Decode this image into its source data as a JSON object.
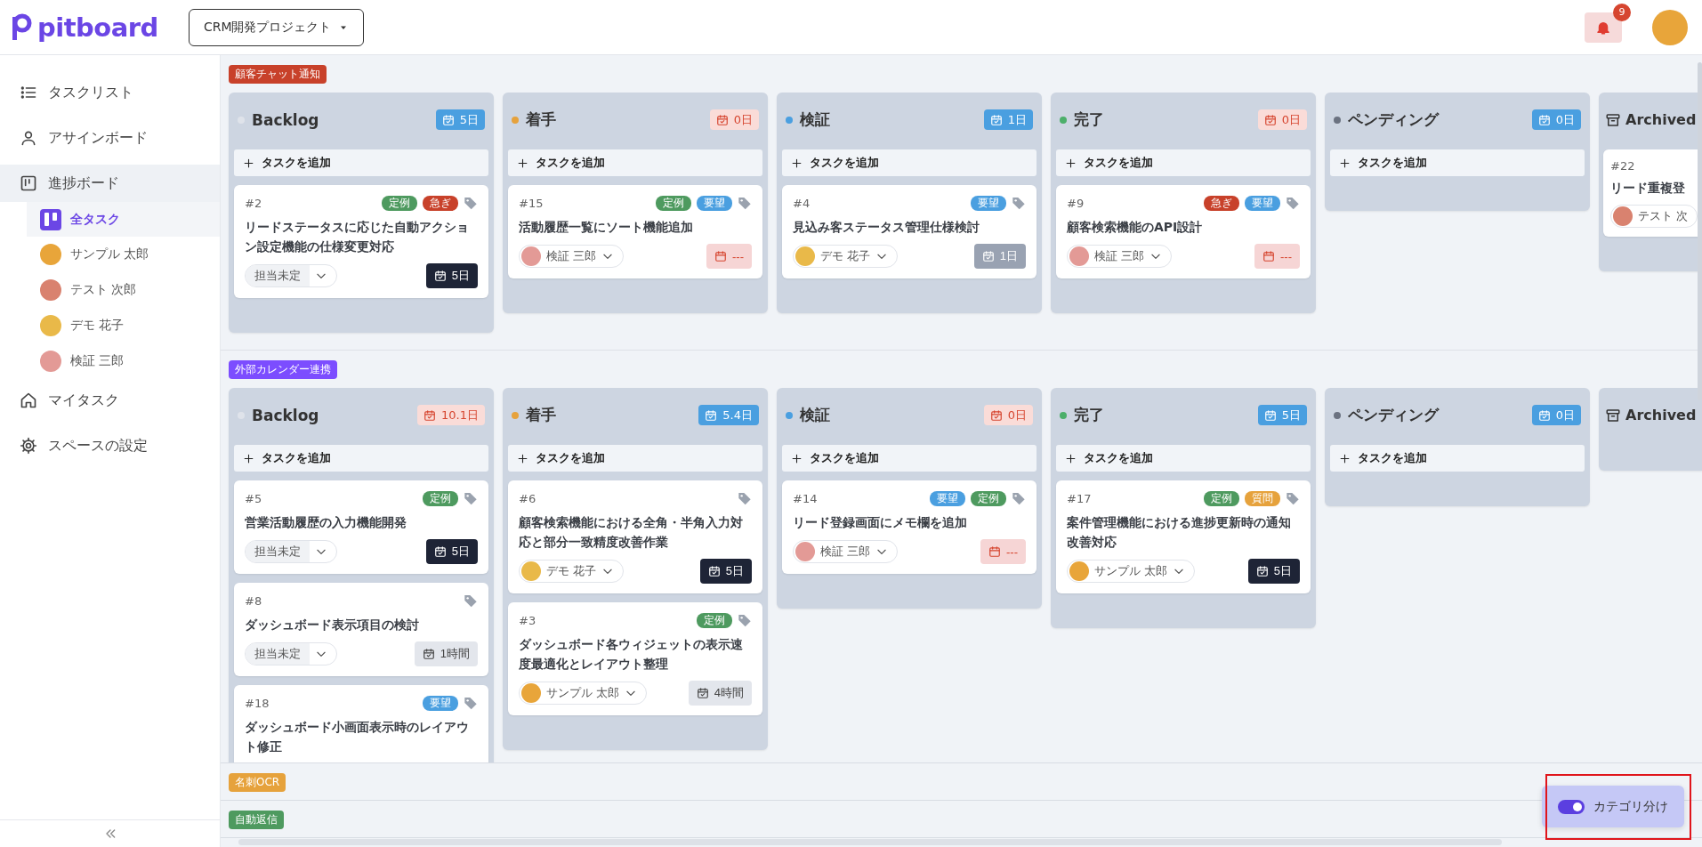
{
  "header": {
    "logo": "pitboard",
    "project": "CRM開発プロジェクト",
    "notification_count": "9"
  },
  "sidebar": {
    "items": [
      {
        "label": "タスクリスト",
        "kind": "list",
        "selected": false
      },
      {
        "label": "アサインボード",
        "kind": "person",
        "selected": false
      },
      {
        "label": "進捗ボード",
        "kind": "board",
        "selected": true,
        "children": [
          {
            "label": "全タスク",
            "kind": "all",
            "selected": true
          },
          {
            "label": "サンプル 太郎",
            "kind": "member",
            "color": "#e8a53a",
            "selected": false
          },
          {
            "label": "テスト 次郎",
            "kind": "member",
            "color": "#d9826f",
            "selected": false
          },
          {
            "label": "デモ 花子",
            "kind": "member",
            "color": "#e9b949",
            "selected": false
          },
          {
            "label": "検証 三郎",
            "kind": "member",
            "color": "#e39a96",
            "selected": false
          }
        ]
      },
      {
        "label": "マイタスク",
        "kind": "home",
        "selected": false
      },
      {
        "label": "スペースの設定",
        "kind": "gear",
        "selected": false
      }
    ]
  },
  "sections": [
    {
      "category": "顧客チャット通知",
      "color": "#c8412a",
      "columns": [
        {
          "title": "Backlog",
          "kind": "status",
          "color": "#dfe3ea",
          "badge": {
            "text": "5日",
            "alert": false
          },
          "add_label": "タスクを追加",
          "cards": [
            {
              "number": "#2",
              "tags": [
                {
                  "label": "定例",
                  "color": "#4e9a5f"
                },
                {
                  "label": "急ぎ",
                  "color": "#c8412a"
                }
              ],
              "title": "リードステータスに応じた自動アクション設定機能の仕様変更対応",
              "assignee": {
                "name": "担当未定",
                "kind": "none"
              },
              "due": {
                "text": "5日",
                "kind": "dark"
              }
            }
          ]
        },
        {
          "title": "着手",
          "kind": "status",
          "color": "#e6a23c",
          "badge": {
            "text": "0日",
            "alert": true
          },
          "add_label": "タスクを追加",
          "cards": [
            {
              "number": "#15",
              "tags": [
                {
                  "label": "定例",
                  "color": "#4e9a5f"
                },
                {
                  "label": "要望",
                  "color": "#4a9fe0"
                }
              ],
              "title": "活動履歴一覧にソート機能追加",
              "assignee": {
                "name": "検証 三郎",
                "kind": "member",
                "color": "#e39a96"
              },
              "due": {
                "text": "---",
                "kind": "overdue"
              }
            }
          ]
        },
        {
          "title": "検証",
          "kind": "status",
          "color": "#4a9fe0",
          "badge": {
            "text": "1日",
            "alert": false
          },
          "add_label": "タスクを追加",
          "cards": [
            {
              "number": "#4",
              "tags": [
                {
                  "label": "要望",
                  "color": "#4a9fe0"
                }
              ],
              "title": "見込み客ステータス管理仕様検討",
              "assignee": {
                "name": "デモ 花子",
                "kind": "member",
                "color": "#e9b949"
              },
              "due": {
                "text": "1日",
                "kind": "grey"
              }
            }
          ]
        },
        {
          "title": "完了",
          "kind": "status",
          "color": "#4caf6a",
          "badge": {
            "text": "0日",
            "alert": true
          },
          "add_label": "タスクを追加",
          "cards": [
            {
              "number": "#9",
              "tags": [
                {
                  "label": "急ぎ",
                  "color": "#c8412a"
                },
                {
                  "label": "要望",
                  "color": "#4a9fe0"
                }
              ],
              "title": "顧客検索機能のAPI設計",
              "assignee": {
                "name": "検証 三郎",
                "kind": "member",
                "color": "#e39a96"
              },
              "due": {
                "text": "---",
                "kind": "overdue"
              }
            }
          ]
        },
        {
          "title": "ペンディング",
          "kind": "status",
          "color": "#6b7280",
          "badge": {
            "text": "0日",
            "alert": false
          },
          "add_label": "タスクを追加"
        },
        {
          "title": "Archived",
          "kind": "archive",
          "cards": [
            {
              "number": "#22",
              "title": "リード重複登",
              "assignee": {
                "name": "テスト 次",
                "kind": "member",
                "color": "#d9826f"
              }
            }
          ]
        }
      ]
    },
    {
      "category": "外部カレンダー連携",
      "color": "#7c4dff",
      "columns": [
        {
          "title": "Backlog",
          "kind": "status",
          "color": "#dfe3ea",
          "badge": {
            "text": "10.1日",
            "alert": true
          },
          "add_label": "タスクを追加",
          "cards": [
            {
              "number": "#5",
              "tags": [
                {
                  "label": "定例",
                  "color": "#4e9a5f"
                }
              ],
              "title": "営業活動履歴の入力機能開発",
              "assignee": {
                "name": "担当未定",
                "kind": "none"
              },
              "due": {
                "text": "5日",
                "kind": "dark"
              }
            },
            {
              "number": "#8",
              "title": "ダッシュボード表示項目の検討",
              "assignee": {
                "name": "担当未定",
                "kind": "none"
              },
              "due": {
                "text": "1時間",
                "kind": "light"
              }
            },
            {
              "number": "#18",
              "tags": [
                {
                  "label": "要望",
                  "color": "#4a9fe0"
                }
              ],
              "title": "ダッシュボード小画面表示時のレイアウト修正"
            }
          ]
        },
        {
          "title": "着手",
          "kind": "status",
          "color": "#e6a23c",
          "badge": {
            "text": "5.4日",
            "alert": false
          },
          "add_label": "タスクを追加",
          "cards": [
            {
              "number": "#6",
              "title": "顧客検索機能における全角・半角入力対応と部分一致精度改善作業",
              "assignee": {
                "name": "デモ 花子",
                "kind": "member",
                "color": "#e9b949"
              },
              "due": {
                "text": "5日",
                "kind": "dark"
              }
            },
            {
              "number": "#3",
              "tags": [
                {
                  "label": "定例",
                  "color": "#4e9a5f"
                }
              ],
              "title": "ダッシュボード各ウィジェットの表示速度最適化とレイアウト整理",
              "assignee": {
                "name": "サンプル 太郎",
                "kind": "member",
                "color": "#e8a53a"
              },
              "due": {
                "text": "4時間",
                "kind": "light"
              }
            }
          ]
        },
        {
          "title": "検証",
          "kind": "status",
          "color": "#4a9fe0",
          "badge": {
            "text": "0日",
            "alert": true
          },
          "add_label": "タスクを追加",
          "cards": [
            {
              "number": "#14",
              "tags": [
                {
                  "label": "要望",
                  "color": "#4a9fe0"
                },
                {
                  "label": "定例",
                  "color": "#4e9a5f"
                }
              ],
              "title": "リード登録画面にメモ欄を追加",
              "assignee": {
                "name": "検証 三郎",
                "kind": "member",
                "color": "#e39a96"
              },
              "due": {
                "text": "---",
                "kind": "overdue"
              }
            }
          ]
        },
        {
          "title": "完了",
          "kind": "status",
          "color": "#4caf6a",
          "badge": {
            "text": "5日",
            "alert": false
          },
          "add_label": "タスクを追加",
          "cards": [
            {
              "number": "#17",
              "tags": [
                {
                  "label": "定例",
                  "color": "#4e9a5f"
                },
                {
                  "label": "質問",
                  "color": "#e6a23c"
                }
              ],
              "title": "案件管理機能における進捗更新時の通知改善対応",
              "assignee": {
                "name": "サンプル 太郎",
                "kind": "member",
                "color": "#e8a53a"
              },
              "due": {
                "text": "5日",
                "kind": "dark"
              }
            }
          ]
        },
        {
          "title": "ペンディング",
          "kind": "status",
          "color": "#6b7280",
          "badge": {
            "text": "0日",
            "alert": false
          },
          "add_label": "タスクを追加"
        },
        {
          "title": "Archived",
          "kind": "archive"
        }
      ]
    },
    {
      "category": "名刺OCR",
      "color": "#e6a23c"
    },
    {
      "category": "自動返信",
      "color": "#4e9a5f"
    }
  ],
  "toggle": {
    "label": "カテゴリ分け",
    "on": true
  }
}
